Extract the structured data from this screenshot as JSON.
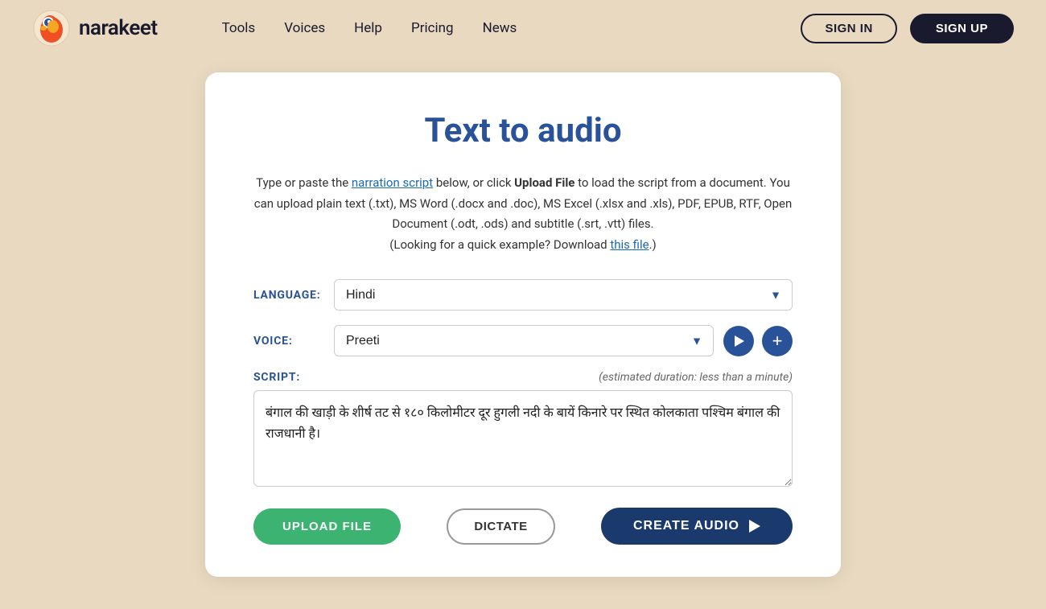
{
  "header": {
    "logo_text": "narakeet",
    "nav": {
      "tools": "Tools",
      "voices": "Voices",
      "help": "Help",
      "pricing": "Pricing",
      "news": "News"
    },
    "signin_label": "SIGN IN",
    "signup_label": "SIGN UP"
  },
  "main": {
    "title": "Text to audio",
    "description_part1": "Type or paste the ",
    "narration_script_link": "narration script",
    "description_part2": " below, or click ",
    "upload_file_bold": "Upload File",
    "description_part3": " to load the script from a document. You can upload plain text (.txt), MS Word (.docx and .doc), MS Excel (.xlsx and .xls), PDF, EPUB, RTF, Open Document (.odt, .ods) and subtitle (.srt, .vtt) files.",
    "description_part4": "(Looking for a quick example? Download ",
    "this_file_link": "this file",
    "description_part5": ".)",
    "language_label": "LANGUAGE:",
    "language_value": "Hindi",
    "voice_label": "VOICE:",
    "voice_value": "Preeti",
    "script_label": "SCRIPT:",
    "duration_text": "(estimated duration: less than a minute)",
    "script_content": "बंगाल की खाड़ी के शीर्ष तट से १८० किलोमीटर दूर हुगली नदी के बायें किनारे पर स्थित कोलकाता पश्चिम बंगाल की राजधानी है।",
    "upload_file_btn": "UPLOAD FILE",
    "dictate_btn": "DICTATE",
    "create_audio_btn": "CREATE AUDIO"
  },
  "colors": {
    "background": "#e8d9c0",
    "primary_blue": "#2a5298",
    "dark_navy": "#1a1a2e",
    "green": "#3cb371",
    "create_audio_bg": "#1a3a6e"
  }
}
